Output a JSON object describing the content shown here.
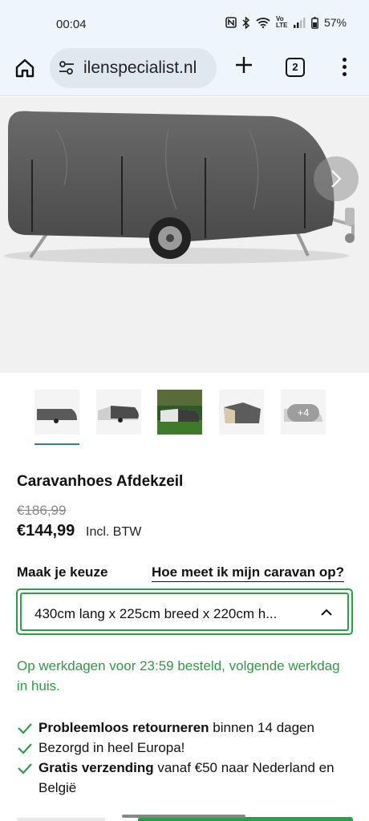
{
  "status_bar": {
    "time": "00:04",
    "signal_badge": "Vo LTE",
    "battery": "57%",
    "icons": [
      "nfc-icon",
      "bluetooth-icon",
      "wifi-icon",
      "volte-icon",
      "signal-icon",
      "battery-icon"
    ]
  },
  "browser": {
    "url": "ilenspecialist.nl",
    "tab_count": "2",
    "icons": [
      "home-icon",
      "site-settings-icon",
      "new-tab-icon",
      "tabs-icon",
      "more-vert-icon"
    ]
  },
  "gallery": {
    "next_icon": "chevron-right-icon",
    "more_label": "+4",
    "thumbnails": [
      "caravan-cover-grey",
      "caravan-cover-white",
      "caravan-cover-outdoor",
      "caravan-cover-angle",
      "more-images"
    ],
    "active_index": 0
  },
  "product": {
    "title": "Caravanhoes Afdekzeil",
    "old_price": "€186,99",
    "price": "€144,99",
    "price_note": "Incl. BTW"
  },
  "options": {
    "label": "Maak je keuze",
    "measure_link": "Hoe meet ik mijn caravan op?",
    "selected": "430cm lang x 225cm breed x 220cm h..."
  },
  "delivery_note": "Op werkdagen voor 23:59 besteld, volgende werkdag in huis.",
  "usps": [
    {
      "bold": "Probleemloos retourneren",
      "rest": " binnen 14 dagen"
    },
    {
      "bold": "",
      "rest": "Bezorgd in heel Europa!"
    },
    {
      "bold": "Gratis verzending",
      "rest": " vanaf €50 naar Nederland en België"
    }
  ],
  "colors": {
    "accent_green": "#2d9e48",
    "browser_bar": "#eef6fb",
    "url_pill": "#dfe7ef",
    "cover_grey": "#5a5a5a"
  }
}
